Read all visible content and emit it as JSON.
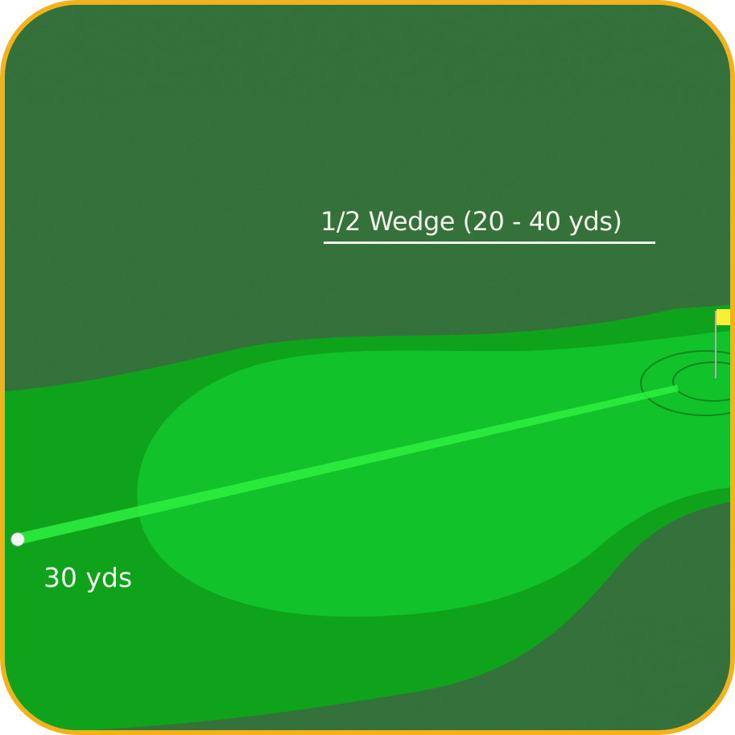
{
  "shot": {
    "title": "1/2 Wedge (20 - 40 yds)",
    "distance_label": "30 yds"
  },
  "colors": {
    "frame_border": "#f2b21c",
    "rough": "#2e6b34",
    "fairway": "#0fa31c",
    "landing_zone": "#12c22a",
    "shot_line": "#2ef040",
    "flag": "#f7f03a",
    "text": "#f2f2ea"
  },
  "icons": {
    "ball": "golf-ball-icon",
    "flag": "flag-icon"
  }
}
